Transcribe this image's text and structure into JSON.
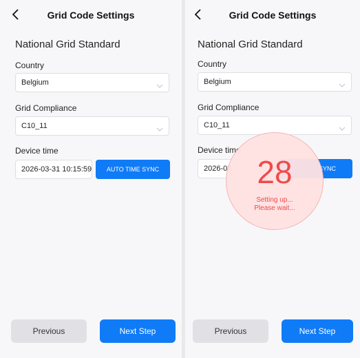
{
  "screens": [
    {
      "header": {
        "title": "Grid Code Settings"
      },
      "section_title": "National Grid Standard",
      "country": {
        "label": "Country",
        "value": "Belgium"
      },
      "grid_compliance": {
        "label": "Grid Compliance",
        "value": "C10_11"
      },
      "device_time": {
        "label": "Device time",
        "value": "2026-03-31 10:15:59",
        "sync_button": "AUTO TIME SYNC"
      },
      "footer": {
        "previous": "Previous",
        "next": "Next Step"
      }
    },
    {
      "header": {
        "title": "Grid Code Settings"
      },
      "section_title": "National Grid Standard",
      "country": {
        "label": "Country",
        "value": "Belgium"
      },
      "grid_compliance": {
        "label": "Grid Compliance",
        "value": "C10_11"
      },
      "device_time": {
        "label": "Device time",
        "value": "2026-03",
        "sync_button": "SYNC"
      },
      "footer": {
        "previous": "Previous",
        "next": "Next Step"
      },
      "overlay": {
        "countdown": "28",
        "line1": "Setting up...",
        "line2": "Please wait..."
      }
    }
  ],
  "colors": {
    "accent": "#0f7bf7",
    "overlay_text": "#f04a4a",
    "overlay_fill": "#ffe2e2"
  },
  "icons": {
    "back": "chevron-left-icon",
    "dropdown": "chevron-down-icon"
  }
}
